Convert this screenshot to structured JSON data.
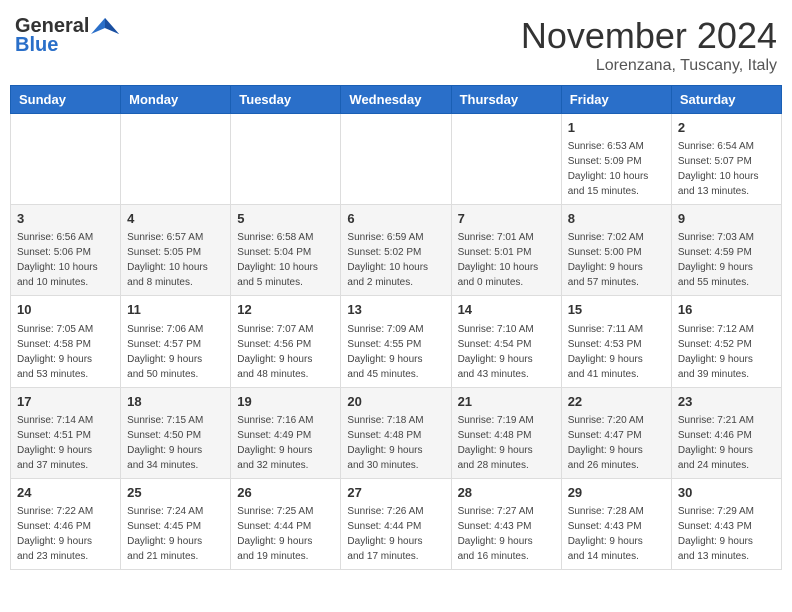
{
  "header": {
    "logo_general": "General",
    "logo_blue": "Blue",
    "month_title": "November 2024",
    "location": "Lorenzana, Tuscany, Italy"
  },
  "days_of_week": [
    "Sunday",
    "Monday",
    "Tuesday",
    "Wednesday",
    "Thursday",
    "Friday",
    "Saturday"
  ],
  "weeks": [
    [
      {
        "day": "",
        "info": ""
      },
      {
        "day": "",
        "info": ""
      },
      {
        "day": "",
        "info": ""
      },
      {
        "day": "",
        "info": ""
      },
      {
        "day": "",
        "info": ""
      },
      {
        "day": "1",
        "info": "Sunrise: 6:53 AM\nSunset: 5:09 PM\nDaylight: 10 hours\nand 15 minutes."
      },
      {
        "day": "2",
        "info": "Sunrise: 6:54 AM\nSunset: 5:07 PM\nDaylight: 10 hours\nand 13 minutes."
      }
    ],
    [
      {
        "day": "3",
        "info": "Sunrise: 6:56 AM\nSunset: 5:06 PM\nDaylight: 10 hours\nand 10 minutes."
      },
      {
        "day": "4",
        "info": "Sunrise: 6:57 AM\nSunset: 5:05 PM\nDaylight: 10 hours\nand 8 minutes."
      },
      {
        "day": "5",
        "info": "Sunrise: 6:58 AM\nSunset: 5:04 PM\nDaylight: 10 hours\nand 5 minutes."
      },
      {
        "day": "6",
        "info": "Sunrise: 6:59 AM\nSunset: 5:02 PM\nDaylight: 10 hours\nand 2 minutes."
      },
      {
        "day": "7",
        "info": "Sunrise: 7:01 AM\nSunset: 5:01 PM\nDaylight: 10 hours\nand 0 minutes."
      },
      {
        "day": "8",
        "info": "Sunrise: 7:02 AM\nSunset: 5:00 PM\nDaylight: 9 hours\nand 57 minutes."
      },
      {
        "day": "9",
        "info": "Sunrise: 7:03 AM\nSunset: 4:59 PM\nDaylight: 9 hours\nand 55 minutes."
      }
    ],
    [
      {
        "day": "10",
        "info": "Sunrise: 7:05 AM\nSunset: 4:58 PM\nDaylight: 9 hours\nand 53 minutes."
      },
      {
        "day": "11",
        "info": "Sunrise: 7:06 AM\nSunset: 4:57 PM\nDaylight: 9 hours\nand 50 minutes."
      },
      {
        "day": "12",
        "info": "Sunrise: 7:07 AM\nSunset: 4:56 PM\nDaylight: 9 hours\nand 48 minutes."
      },
      {
        "day": "13",
        "info": "Sunrise: 7:09 AM\nSunset: 4:55 PM\nDaylight: 9 hours\nand 45 minutes."
      },
      {
        "day": "14",
        "info": "Sunrise: 7:10 AM\nSunset: 4:54 PM\nDaylight: 9 hours\nand 43 minutes."
      },
      {
        "day": "15",
        "info": "Sunrise: 7:11 AM\nSunset: 4:53 PM\nDaylight: 9 hours\nand 41 minutes."
      },
      {
        "day": "16",
        "info": "Sunrise: 7:12 AM\nSunset: 4:52 PM\nDaylight: 9 hours\nand 39 minutes."
      }
    ],
    [
      {
        "day": "17",
        "info": "Sunrise: 7:14 AM\nSunset: 4:51 PM\nDaylight: 9 hours\nand 37 minutes."
      },
      {
        "day": "18",
        "info": "Sunrise: 7:15 AM\nSunset: 4:50 PM\nDaylight: 9 hours\nand 34 minutes."
      },
      {
        "day": "19",
        "info": "Sunrise: 7:16 AM\nSunset: 4:49 PM\nDaylight: 9 hours\nand 32 minutes."
      },
      {
        "day": "20",
        "info": "Sunrise: 7:18 AM\nSunset: 4:48 PM\nDaylight: 9 hours\nand 30 minutes."
      },
      {
        "day": "21",
        "info": "Sunrise: 7:19 AM\nSunset: 4:48 PM\nDaylight: 9 hours\nand 28 minutes."
      },
      {
        "day": "22",
        "info": "Sunrise: 7:20 AM\nSunset: 4:47 PM\nDaylight: 9 hours\nand 26 minutes."
      },
      {
        "day": "23",
        "info": "Sunrise: 7:21 AM\nSunset: 4:46 PM\nDaylight: 9 hours\nand 24 minutes."
      }
    ],
    [
      {
        "day": "24",
        "info": "Sunrise: 7:22 AM\nSunset: 4:46 PM\nDaylight: 9 hours\nand 23 minutes."
      },
      {
        "day": "25",
        "info": "Sunrise: 7:24 AM\nSunset: 4:45 PM\nDaylight: 9 hours\nand 21 minutes."
      },
      {
        "day": "26",
        "info": "Sunrise: 7:25 AM\nSunset: 4:44 PM\nDaylight: 9 hours\nand 19 minutes."
      },
      {
        "day": "27",
        "info": "Sunrise: 7:26 AM\nSunset: 4:44 PM\nDaylight: 9 hours\nand 17 minutes."
      },
      {
        "day": "28",
        "info": "Sunrise: 7:27 AM\nSunset: 4:43 PM\nDaylight: 9 hours\nand 16 minutes."
      },
      {
        "day": "29",
        "info": "Sunrise: 7:28 AM\nSunset: 4:43 PM\nDaylight: 9 hours\nand 14 minutes."
      },
      {
        "day": "30",
        "info": "Sunrise: 7:29 AM\nSunset: 4:43 PM\nDaylight: 9 hours\nand 13 minutes."
      }
    ]
  ]
}
